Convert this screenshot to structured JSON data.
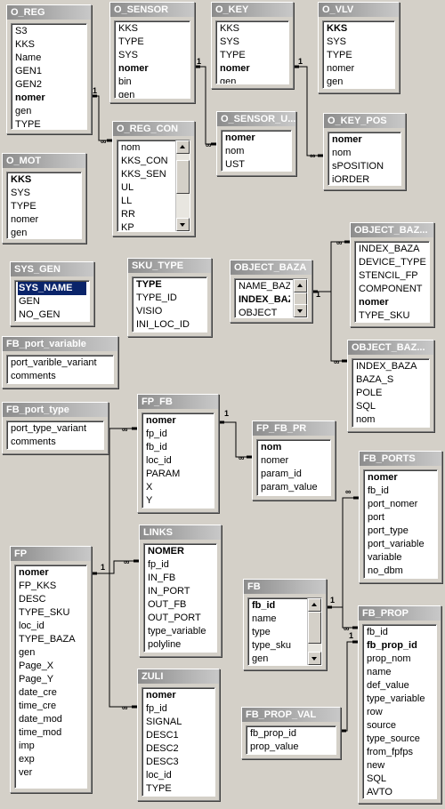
{
  "tables": [
    {
      "id": "O_REG",
      "title": "O_REG",
      "fields": [
        "S3",
        "KKS",
        "Name",
        "GEN1",
        "GEN2",
        "nomer",
        "gen",
        "TYPE"
      ],
      "key_fields": [
        "nomer"
      ]
    },
    {
      "id": "O_SENSOR",
      "title": "O_SENSOR",
      "fields": [
        "KKS",
        "TYPE",
        "SYS",
        "nomer",
        "bin",
        "gen"
      ],
      "key_fields": [
        "nomer"
      ]
    },
    {
      "id": "O_KEY",
      "title": "O_KEY",
      "fields": [
        "KKS",
        "SYS",
        "TYPE",
        "nomer",
        "gen"
      ],
      "key_fields": [
        "nomer"
      ]
    },
    {
      "id": "O_VLV",
      "title": "O_VLV",
      "fields": [
        "KKS",
        "SYS",
        "TYPE",
        "nomer",
        "gen"
      ],
      "key_fields": [
        "KKS"
      ]
    },
    {
      "id": "O_REG_CON",
      "title": "O_REG_CON",
      "fields": [
        "nom",
        "KKS_CON",
        "KKS_SEN",
        "UL",
        "LL",
        "RR",
        "KP"
      ],
      "key_fields": []
    },
    {
      "id": "O_SENSOR_U",
      "title": "O_SENSOR_U...",
      "fields": [
        "nomer",
        "nom",
        "UST"
      ],
      "key_fields": [
        "nomer"
      ]
    },
    {
      "id": "O_KEY_POS",
      "title": "O_KEY_POS",
      "fields": [
        "nomer",
        "nom",
        "sPOSITION",
        "iORDER"
      ],
      "key_fields": [
        "nomer"
      ]
    },
    {
      "id": "O_MOT",
      "title": "O_MOT",
      "fields": [
        "KKS",
        "SYS",
        "TYPE",
        "nomer",
        "gen"
      ],
      "key_fields": [
        "KKS"
      ]
    },
    {
      "id": "SYS_GEN",
      "title": "SYS_GEN",
      "fields": [
        "SYS_NAME",
        "GEN",
        "NO_GEN"
      ],
      "key_fields": [
        "SYS_NAME"
      ],
      "selected": "SYS_NAME"
    },
    {
      "id": "SKU_TYPE",
      "title": "SKU_TYPE",
      "fields": [
        "TYPE",
        "TYPE_ID",
        "VISIO",
        "INI_LOC_ID"
      ],
      "key_fields": [
        "TYPE"
      ]
    },
    {
      "id": "OBJECT_BAZA",
      "title": "OBJECT_BAZA",
      "fields": [
        "NAME_BAZA",
        "INDEX_BAZA",
        "OBJECT"
      ],
      "key_fields": [
        "INDEX_BAZA"
      ]
    },
    {
      "id": "OBJECT_BAZ_1",
      "title": "OBJECT_BAZ...",
      "fields": [
        "INDEX_BAZA",
        "DEVICE_TYPE",
        "STENCIL_FP",
        "COMPONENT",
        "nomer",
        "TYPE_SKU"
      ],
      "key_fields": [
        "nomer"
      ]
    },
    {
      "id": "OBJECT_BAZ_2",
      "title": "OBJECT_BAZ...",
      "fields": [
        "INDEX_BAZA",
        "BAZA_S",
        "POLE",
        "SQL",
        "nom"
      ],
      "key_fields": []
    },
    {
      "id": "FB_port_variable",
      "title": "FB_port_variable",
      "fields": [
        "port_varible_variant",
        "comments"
      ],
      "key_fields": []
    },
    {
      "id": "FB_port_type",
      "title": "FB_port_type",
      "fields": [
        "port_type_variant",
        "comments"
      ],
      "key_fields": []
    },
    {
      "id": "FP_FB",
      "title": "FP_FB",
      "fields": [
        "nomer",
        "fp_id",
        "fb_id",
        "loc_id",
        "PARAM",
        "X",
        "Y"
      ],
      "key_fields": [
        "nomer"
      ]
    },
    {
      "id": "FP_FB_PR",
      "title": "FP_FB_PR",
      "fields": [
        "nom",
        "nomer",
        "param_id",
        "param_value"
      ],
      "key_fields": [
        "nom"
      ]
    },
    {
      "id": "FB_PORTS",
      "title": "FB_PORTS",
      "fields": [
        "nomer",
        "fb_id",
        "port_nomer",
        "port",
        "port_type",
        "port_variable",
        "variable",
        "no_dbm"
      ],
      "key_fields": [
        "nomer"
      ]
    },
    {
      "id": "LINKS",
      "title": "LINKS",
      "fields": [
        "NOMER",
        "fp_id",
        "IN_FB",
        "IN_PORT",
        "OUT_FB",
        "OUT_PORT",
        "type_variable",
        "polyline"
      ],
      "key_fields": [
        "NOMER"
      ]
    },
    {
      "id": "FP",
      "title": "FP",
      "fields": [
        "nomer",
        "FP_KKS",
        "DESC",
        "TYPE_SKU",
        "loc_id",
        "TYPE_BAZA",
        "gen",
        "Page_X",
        "Page_Y",
        "date_cre",
        "time_cre",
        "date_mod",
        "time_mod",
        "imp",
        "exp",
        "ver"
      ],
      "key_fields": [
        "nomer"
      ]
    },
    {
      "id": "FB",
      "title": "FB",
      "fields": [
        "fb_id",
        "name",
        "type",
        "type_sku",
        "gen"
      ],
      "key_fields": [
        "fb_id"
      ]
    },
    {
      "id": "FB_PROP",
      "title": "FB_PROP",
      "fields": [
        "fb_id",
        "fb_prop_id",
        "prop_nom",
        "name",
        "def_value",
        "type_variable",
        "row",
        "source",
        "type_source",
        "from_fpfps",
        "new",
        "SQL",
        "AVTO"
      ],
      "key_fields": [
        "fb_prop_id"
      ]
    },
    {
      "id": "ZULI",
      "title": "ZULI",
      "fields": [
        "nomer",
        "fp_id",
        "SIGNAL",
        "DESC1",
        "DESC2",
        "DESC3",
        "loc_id",
        "TYPE"
      ],
      "key_fields": [
        "nomer"
      ]
    },
    {
      "id": "FB_PROP_VAL",
      "title": "FB_PROP_VAL",
      "fields": [
        "fb_prop_id",
        "prop_value"
      ],
      "key_fields": []
    }
  ],
  "relationships": [
    {
      "from": "O_REG",
      "to": "O_REG_CON",
      "one": "1",
      "many": "∞"
    },
    {
      "from": "O_SENSOR",
      "to": "O_SENSOR_U",
      "one": "1",
      "many": "∞"
    },
    {
      "from": "O_KEY",
      "to": "O_KEY_POS",
      "one": "1",
      "many": "∞"
    },
    {
      "from": "OBJECT_BAZA",
      "to": "OBJECT_BAZ_1",
      "one": "1",
      "many": "∞"
    },
    {
      "from": "OBJECT_BAZA",
      "to": "OBJECT_BAZ_2",
      "one": "1",
      "many": "∞"
    },
    {
      "from": "FP_FB",
      "to": "FP_FB_PR",
      "one": "1",
      "many": "∞"
    },
    {
      "from": "FP",
      "to": "FP_FB",
      "one": "1",
      "many": "∞"
    },
    {
      "from": "FP",
      "to": "LINKS",
      "one": "1",
      "many": "∞"
    },
    {
      "from": "FP",
      "to": "ZULI",
      "one": "1",
      "many": "∞"
    },
    {
      "from": "FB",
      "to": "FB_PORTS",
      "one": "1",
      "many": "∞"
    },
    {
      "from": "FB",
      "to": "FB_PROP",
      "one": "1",
      "many": "∞"
    },
    {
      "from": "FB_PROP",
      "to": "FB_PROP_VAL",
      "one": "1",
      "many": "∞"
    }
  ]
}
